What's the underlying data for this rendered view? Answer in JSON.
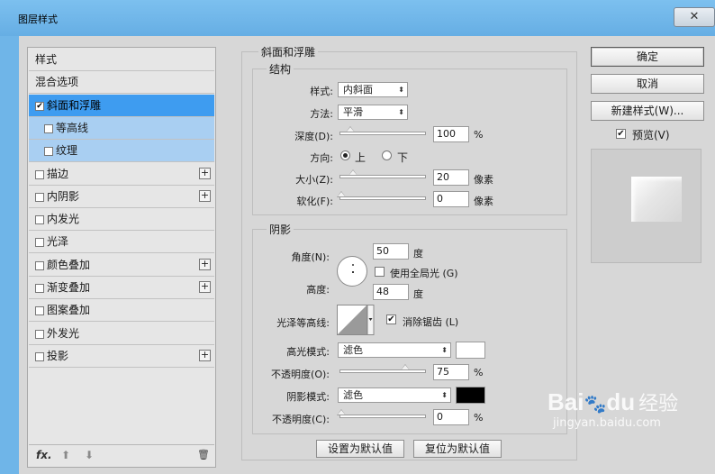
{
  "window": {
    "title": "图层样式",
    "close_label": "✕"
  },
  "left": {
    "items": [
      {
        "label": "样式",
        "checkbox": false,
        "plus": false
      },
      {
        "label": "混合选项",
        "checkbox": false,
        "plus": false
      },
      {
        "label": "斜面和浮雕",
        "checkbox": true,
        "checked": true,
        "plus": false
      },
      {
        "label": "等高线",
        "checkbox": true,
        "checked": false,
        "plus": false
      },
      {
        "label": "纹理",
        "checkbox": true,
        "checked": false,
        "plus": false
      },
      {
        "label": "描边",
        "checkbox": true,
        "checked": false,
        "plus": true
      },
      {
        "label": "内阴影",
        "checkbox": true,
        "checked": false,
        "plus": true
      },
      {
        "label": "内发光",
        "checkbox": true,
        "checked": false,
        "plus": false
      },
      {
        "label": "光泽",
        "checkbox": true,
        "checked": false,
        "plus": false
      },
      {
        "label": "颜色叠加",
        "checkbox": true,
        "checked": false,
        "plus": true
      },
      {
        "label": "渐变叠加",
        "checkbox": true,
        "checked": false,
        "plus": true
      },
      {
        "label": "图案叠加",
        "checkbox": true,
        "checked": false,
        "plus": false
      },
      {
        "label": "外发光",
        "checkbox": true,
        "checked": false,
        "plus": false
      },
      {
        "label": "投影",
        "checkbox": true,
        "checked": false,
        "plus": true
      }
    ],
    "bottom": {
      "fx": "fx.",
      "up": "⬆",
      "down": "⬇",
      "trash": "🗑"
    }
  },
  "bevel": {
    "section_title": "斜面和浮雕",
    "structure": {
      "title": "结构",
      "style_label": "样式:",
      "style_value": "内斜面",
      "technique_label": "方法:",
      "technique_value": "平滑",
      "depth_label": "深度(D):",
      "depth_value": "100",
      "depth_unit": "%",
      "direction_label": "方向:",
      "dir_up": "上",
      "dir_down": "下",
      "size_label": "大小(Z):",
      "size_value": "20",
      "size_unit": "像素",
      "soften_label": "软化(F):",
      "soften_value": "0",
      "soften_unit": "像素"
    },
    "shading": {
      "title": "阴影",
      "angle_label": "角度(N):",
      "angle_value": "50",
      "angle_unit": "度",
      "global_light_label": "使用全局光 (G)",
      "altitude_label": "高度:",
      "altitude_value": "48",
      "altitude_unit": "度",
      "gloss_label": "光泽等高线:",
      "antialias_label": "消除锯齿 (L)",
      "highlight_mode_label": "高光模式:",
      "highlight_mode_value": "滤色",
      "highlight_color": "#ffffff",
      "hl_opacity_label": "不透明度(O):",
      "hl_opacity_value": "75",
      "hl_opacity_unit": "%",
      "shadow_mode_label": "阴影模式:",
      "shadow_mode_value": "滤色",
      "shadow_color": "#000000",
      "sh_opacity_label": "不透明度(C):",
      "sh_opacity_value": "0",
      "sh_opacity_unit": "%"
    },
    "make_default": "设置为默认值",
    "reset_default": "复位为默认值"
  },
  "buttons": {
    "ok": "确定",
    "cancel": "取消",
    "new_style": "新建样式(W)...",
    "preview_label": "预览(V)"
  },
  "watermark": {
    "brand": "Bai",
    "paw": "🐾",
    "brand2": "du",
    "tag": "经验",
    "url": "jingyan.baidu.com"
  }
}
